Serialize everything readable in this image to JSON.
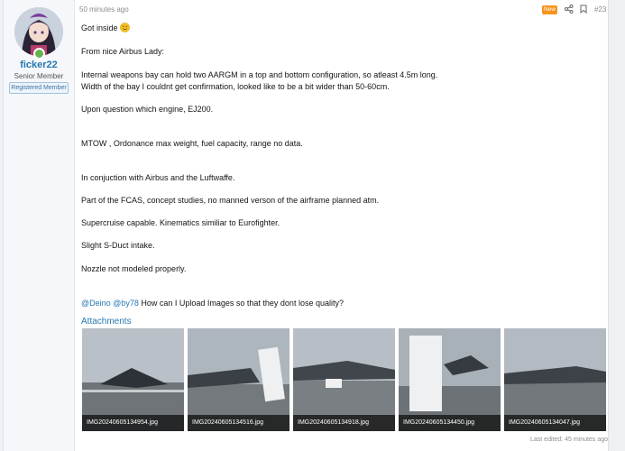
{
  "user": {
    "name": "ficker22",
    "title": "Senior Member",
    "banner": "Registered Member"
  },
  "post": {
    "time": "50 minutes ago",
    "badge": "New",
    "number": "#23",
    "paragraphs": [
      "Got inside",
      "From nice Airbus Lady:",
      "Internal weapons bay can hold two AARGM in a top and bottom configuration, so atleast 4.5m long.",
      "Width of the bay I couldnt get confirmation, looked like to be a bit wider than 50-60cm.",
      "Upon question which engine, EJ200.",
      "MTOW , Ordonance max weight, fuel capacity, range no data.",
      "In conjuction with Airbus and the Luftwaffe.",
      "Part of the FCAS, concept studies, no manned verson of the airframe planned atm.",
      "Supercruise capable. Kinematics similiar to Eurofighter.",
      "Slight S-Duct intake.",
      "Nozzle not modeled properly."
    ],
    "mention1": "@Deino",
    "mention2": "@by78",
    "question": "How can I Upload Images so that they dont lose quality?",
    "emoji": "smile-icon",
    "edited": "Last edited: 45 minutes ago"
  },
  "attachments": {
    "title": "Attachments",
    "files": [
      "IMG20240605134954.jpg",
      "IMG20240605134516.jpg",
      "IMG20240605134918.jpg",
      "IMG20240605134450.jpg",
      "IMG20240605134047.jpg"
    ]
  },
  "colors": {
    "link": "#2577b1",
    "badge": "#f7941d",
    "online": "#63b450"
  }
}
